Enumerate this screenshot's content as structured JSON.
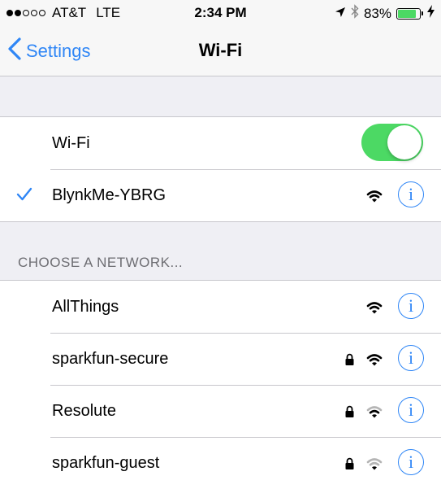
{
  "status_bar": {
    "signal_bars_filled": 2,
    "signal_bars_total": 5,
    "carrier": "AT&T",
    "network_type": "LTE",
    "time": "2:34 PM",
    "battery_percent_text": "83%",
    "battery_level": 0.83,
    "icons": [
      "location-arrow-icon",
      "bluetooth-icon",
      "battery-icon",
      "charging-bolt-icon"
    ]
  },
  "nav": {
    "back_label": "Settings",
    "title": "Wi-Fi"
  },
  "wifi_toggle": {
    "label": "Wi-Fi",
    "on": true
  },
  "connected_network": {
    "name": "BlynkMe-YBRG",
    "secured": false,
    "signal": 3
  },
  "section_header": "CHOOSE A NETWORK...",
  "networks": [
    {
      "name": "AllThings",
      "secured": false,
      "signal": 3
    },
    {
      "name": "sparkfun-secure",
      "secured": true,
      "signal": 3
    },
    {
      "name": "Resolute",
      "secured": true,
      "signal": 2
    },
    {
      "name": "sparkfun-guest",
      "secured": true,
      "signal": 1
    }
  ],
  "info_glyph": "i",
  "colors": {
    "accent": "#2f86f6",
    "toggle_on": "#4cd964",
    "battery": "#4cd964",
    "background": "#efeff4",
    "separator": "#c8c7cc",
    "section_text": "#6d6d72"
  }
}
